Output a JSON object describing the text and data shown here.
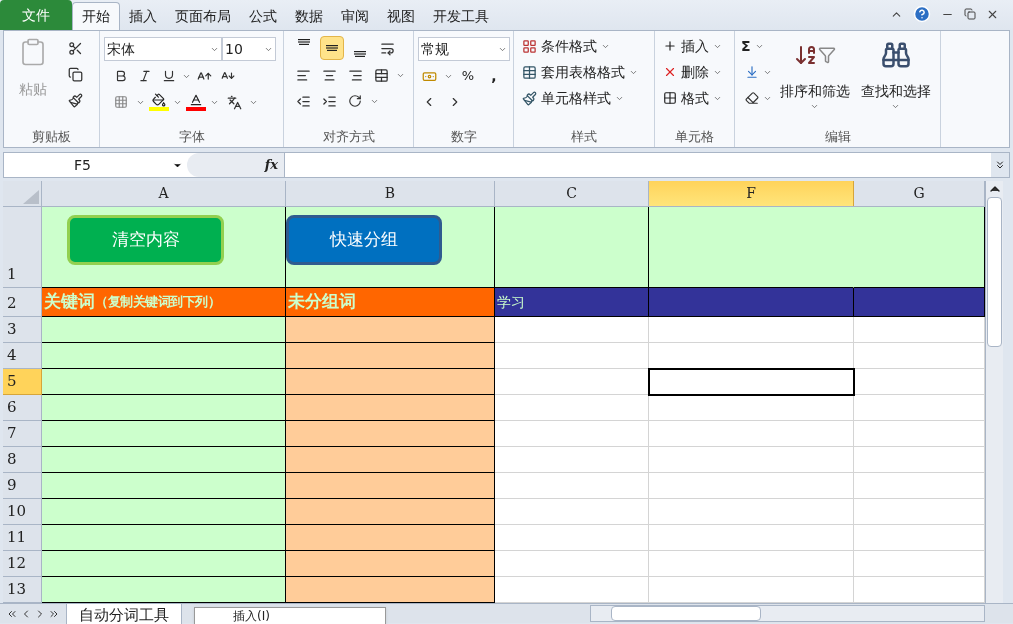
{
  "file_tab": "文件",
  "tabs": [
    {
      "label": "开始",
      "selected": true
    },
    {
      "label": "插入",
      "selected": false
    },
    {
      "label": "页面布局",
      "selected": false
    },
    {
      "label": "公式",
      "selected": false
    },
    {
      "label": "数据",
      "selected": false
    },
    {
      "label": "审阅",
      "selected": false
    },
    {
      "label": "视图",
      "selected": false
    },
    {
      "label": "开发工具",
      "selected": false
    }
  ],
  "ribbon": {
    "clipboard": {
      "title": "剪贴板",
      "paste": {
        "label": "粘贴",
        "disabled": true
      }
    },
    "font": {
      "title": "字体",
      "font_name": "宋体",
      "font_size": "10",
      "swatches": [
        {
          "kind": "fill",
          "color": "#ffff00"
        },
        {
          "kind": "font",
          "color": "#ff0000"
        }
      ]
    },
    "alignment": {
      "title": "对齐方式",
      "buttons": [
        {
          "kind": "top",
          "selected": false
        },
        {
          "kind": "middle",
          "selected": true
        },
        {
          "kind": "bottom",
          "selected": false
        }
      ]
    },
    "number": {
      "title": "数字",
      "format": "常规",
      "percent": "%",
      "comma": ","
    },
    "styles": {
      "title": "样式",
      "items": [
        "条件格式",
        "套用表格格式",
        "单元格样式"
      ]
    },
    "cells": {
      "title": "单元格",
      "items": [
        "插入",
        "删除",
        "格式"
      ]
    },
    "editing": {
      "title": "编辑",
      "sigma": "Σ",
      "items": [
        "排序和筛选",
        "查找和选择"
      ]
    }
  },
  "name_box": "F5",
  "fx": "fx",
  "columns": [
    {
      "label": "A",
      "selected": false,
      "color": "#ccffcc"
    },
    {
      "label": "B",
      "selected": false,
      "color": "#ffcc99"
    },
    {
      "label": "C",
      "selected": false,
      "color": "#ffffff"
    },
    {
      "label": "F",
      "selected": true,
      "color": "#ffffff"
    },
    {
      "label": "G",
      "selected": false,
      "color": "#ffffff"
    }
  ],
  "rows": [
    {
      "label": "1",
      "selected": false,
      "kind": "buttons",
      "color": "#ccffcc",
      "buttons": [
        {
          "label": "清空内容",
          "color": "#00b050"
        },
        {
          "label": "快速分组",
          "color": "#0070c0"
        }
      ]
    },
    {
      "label": "2",
      "selected": false,
      "kind": "header",
      "cells": [
        {
          "text": "关键词",
          "note": "（复制关键词到下列）",
          "color": "#ff6600"
        },
        {
          "text": "未分组词",
          "color": "#ff6600"
        },
        {
          "text": "学习",
          "color": "#333399"
        },
        {
          "color": "#333399"
        },
        {
          "color": "#333399"
        }
      ]
    },
    {
      "label": "3",
      "selected": false,
      "kind": "data"
    },
    {
      "label": "4",
      "selected": false,
      "kind": "data"
    },
    {
      "label": "5",
      "selected": true,
      "kind": "data"
    },
    {
      "label": "6",
      "selected": false,
      "kind": "data"
    },
    {
      "label": "7",
      "selected": false,
      "kind": "data"
    },
    {
      "label": "8",
      "selected": false,
      "kind": "data"
    },
    {
      "label": "9",
      "selected": false,
      "kind": "data"
    },
    {
      "label": "10",
      "selected": false,
      "kind": "data"
    },
    {
      "label": "11",
      "selected": false,
      "kind": "data"
    },
    {
      "label": "12",
      "selected": false,
      "kind": "data"
    },
    {
      "label": "13",
      "selected": false,
      "kind": "data"
    }
  ],
  "sheet_tabs": [
    {
      "label": "自动分词工具",
      "selected": true
    }
  ],
  "context_menu": [
    "插入(I)"
  ]
}
